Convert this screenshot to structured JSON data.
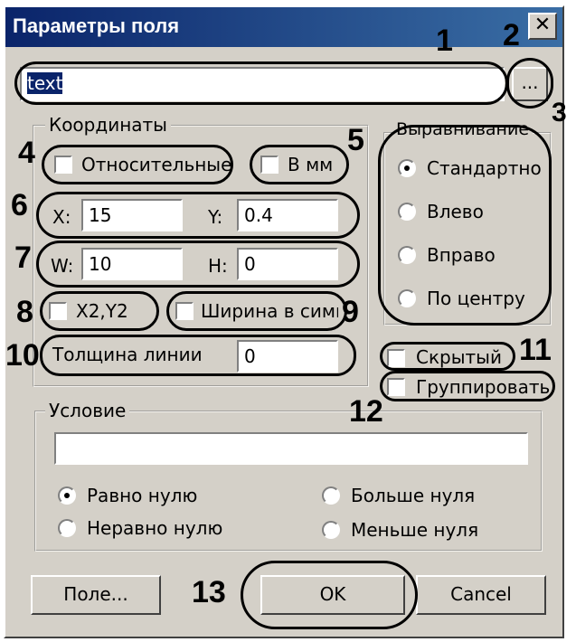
{
  "title": "Параметры поля",
  "close_symbol": "✕",
  "field_text": "text",
  "browse_label": "...",
  "coords": {
    "legend": "Координаты",
    "relative": "Относительные",
    "in_mm": "В мм",
    "x_label": "X:",
    "x_value": "15",
    "y_label": "Y:",
    "y_value": "0.4",
    "w_label": "W:",
    "w_value": "10",
    "h_label": "H:",
    "h_value": "0",
    "x2y2": "X2,Y2",
    "width_chars": "Ширина в симв",
    "line_width_label": "Толщина линии",
    "line_width_value": "0"
  },
  "align": {
    "legend": "Выравнивание",
    "options": [
      "Стандартно",
      "Влево",
      "Вправо",
      "По центру"
    ],
    "selected": "Стандартно"
  },
  "hidden": "Скрытый",
  "group": "Группировать",
  "condition": {
    "legend": "Условие",
    "value": "",
    "options": [
      "Равно нулю",
      "Неравно нулю",
      "Больше нуля",
      "Меньше нуля"
    ],
    "selected": "Равно нулю"
  },
  "buttons": {
    "field": "Поле...",
    "ok": "OK",
    "cancel": "Cancel"
  },
  "callouts": [
    "1",
    "2",
    "3",
    "4",
    "5",
    "6",
    "7",
    "8",
    "9",
    "10",
    "11",
    "12",
    "13"
  ]
}
